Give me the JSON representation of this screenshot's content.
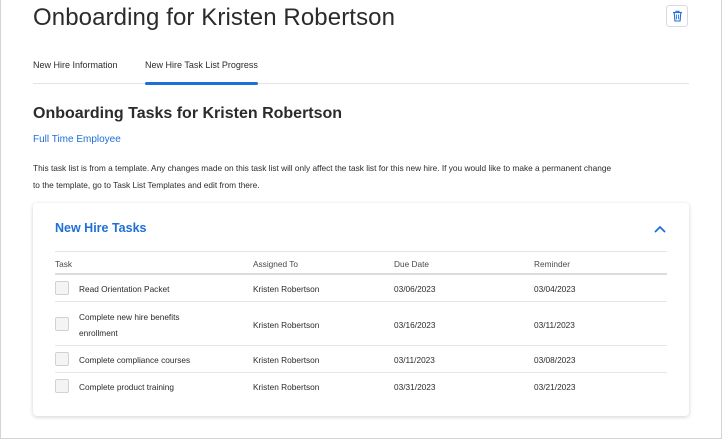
{
  "header": {
    "title": "Onboarding for Kristen Robertson",
    "delete_icon": "trash-icon"
  },
  "tabs": [
    {
      "label": "New Hire Information",
      "active": false
    },
    {
      "label": "New Hire Task List Progress",
      "active": true
    }
  ],
  "main": {
    "section_title": "Onboarding Tasks for Kristen Robertson",
    "employee_type": "Full Time Employee",
    "notice_line1": "This task list is from a template. Any changes made on this task list will only affect the task list for this new hire. If you would like to make a permanent change",
    "notice_line2": "to the template, go to Task List Templates and edit from there."
  },
  "task_card": {
    "title": "New Hire Tasks",
    "collapse_icon": "chevron-up-icon",
    "columns": {
      "task": "Task",
      "assigned_to": "Assigned To",
      "due_date": "Due Date",
      "reminder": "Reminder"
    },
    "rows": [
      {
        "task": "Read Orientation Packet",
        "assigned_to": "Kristen Robertson",
        "due_date": "03/06/2023",
        "reminder": "03/04/2023",
        "checked": false
      },
      {
        "task_line1": "Complete new hire benefits",
        "task_line2": "enrollment",
        "assigned_to": "Kristen Robertson",
        "due_date": "03/16/2023",
        "reminder": "03/11/2023",
        "checked": false
      },
      {
        "task": "Complete compliance courses",
        "assigned_to": "Kristen Robertson",
        "due_date": "03/11/2023",
        "reminder": "03/08/2023",
        "checked": false
      },
      {
        "task": "Complete product training",
        "assigned_to": "Kristen Robertson",
        "due_date": "03/31/2023",
        "reminder": "03/21/2023",
        "checked": false
      }
    ]
  },
  "colors": {
    "accent": "#1e6fd9",
    "text": "#2b2b2b"
  }
}
